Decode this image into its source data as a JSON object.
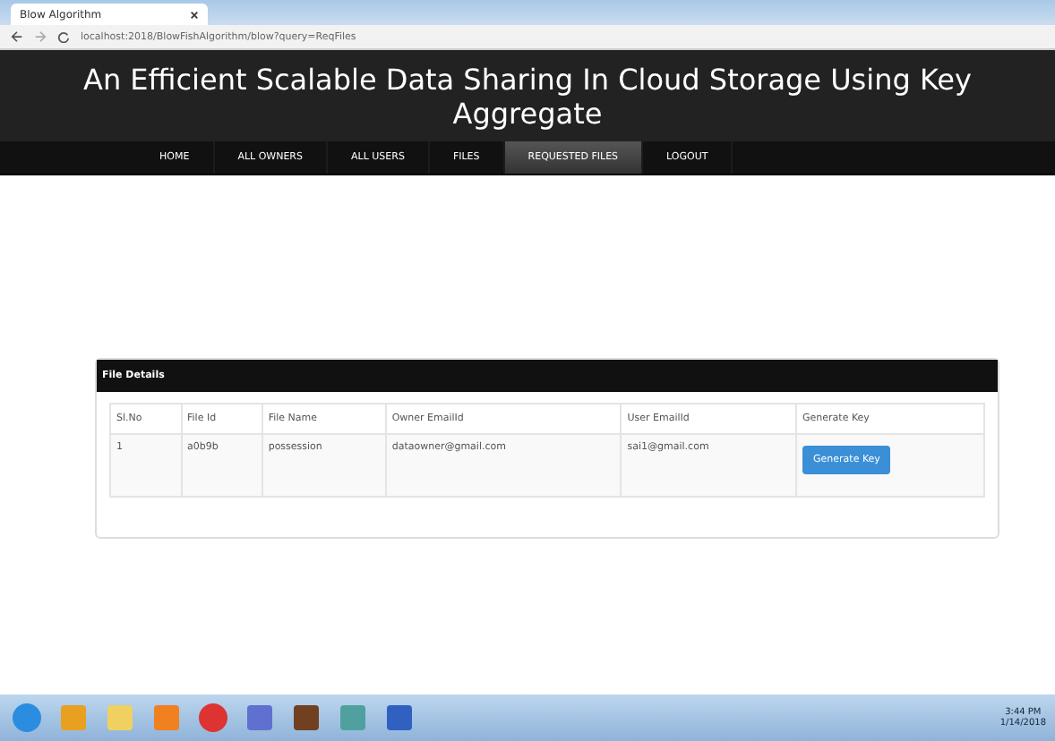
{
  "browser": {
    "tab_title": "Blow Algorithm",
    "url": "localhost:2018/BlowFishAlgorithm/blow?query=ReqFiles"
  },
  "header": {
    "title": "An Efficient Scalable Data Sharing In Cloud Storage Using Key Aggregate"
  },
  "nav": [
    {
      "label": "HOME",
      "selected": false
    },
    {
      "label": "ALL OWNERS",
      "selected": false
    },
    {
      "label": "ALL USERS",
      "selected": false
    },
    {
      "label": "FILES",
      "selected": false
    },
    {
      "label": "REQUESTED FILES",
      "selected": true
    },
    {
      "label": "LOGOUT",
      "selected": false
    }
  ],
  "panel": {
    "title": "File Details",
    "table": {
      "columns": [
        "Sl.No",
        "File Id",
        "File Name",
        "Owner EmailId",
        "User EmailId",
        "Generate Key"
      ],
      "rows": [
        {
          "cells": [
            "1",
            "a0b9b",
            "possession",
            "dataowner@gmail.com",
            "sai1@gmail.com"
          ],
          "button": "Generate Key"
        }
      ]
    }
  },
  "taskbar": {
    "time": "3:44 PM",
    "date": "1/14/2018"
  }
}
